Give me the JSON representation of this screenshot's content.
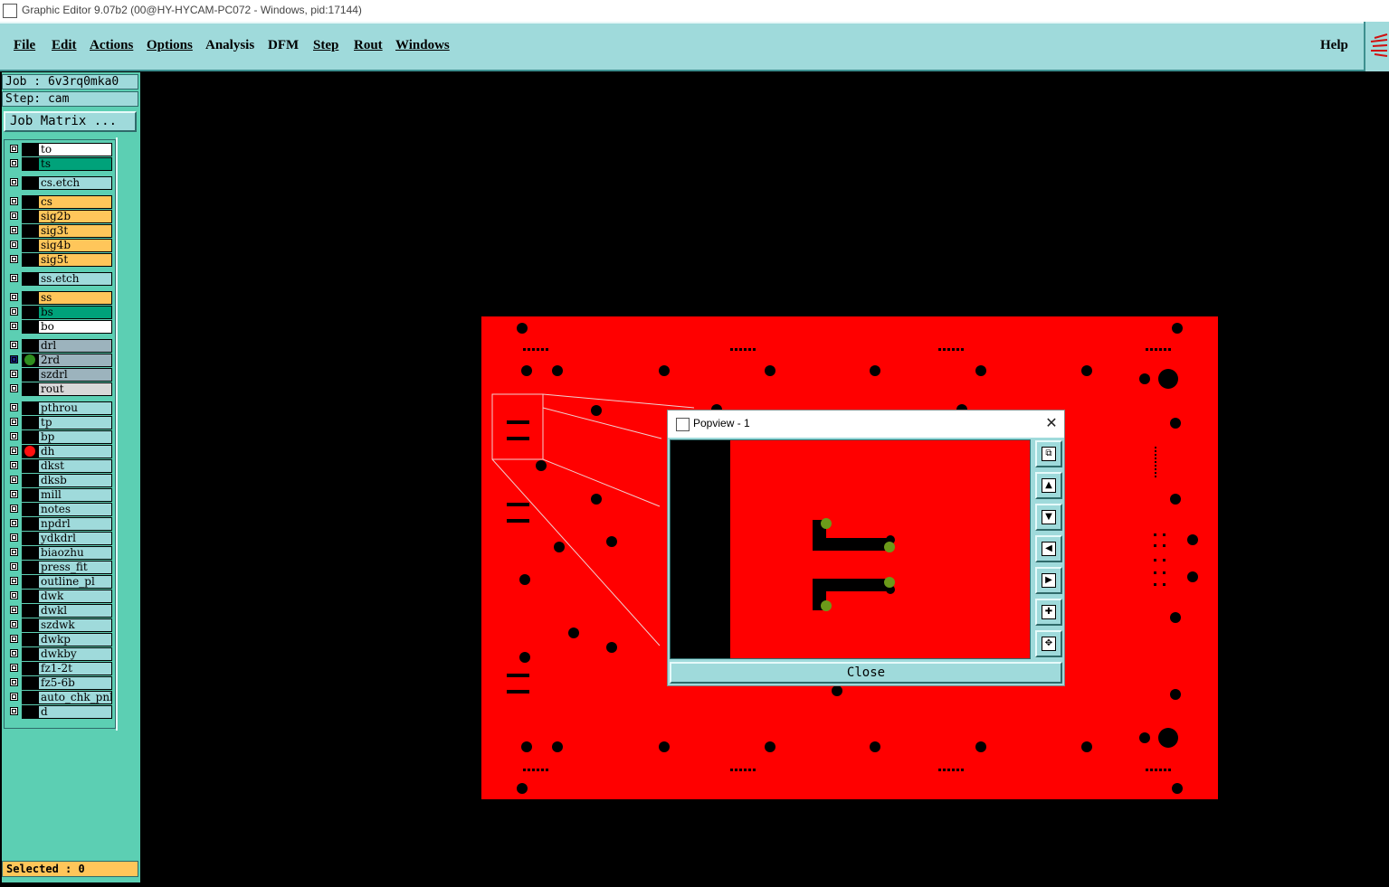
{
  "window": {
    "title": "Graphic Editor 9.07b2 (00@HY-HYCAM-PC072 - Windows, pid:17144)"
  },
  "menu": {
    "file": "File",
    "edit": "Edit",
    "actions": "Actions",
    "options": "Options",
    "analysis": "Analysis",
    "dfm": "DFM",
    "step": "Step",
    "rout": "Rout",
    "windows": "Windows",
    "help": "Help"
  },
  "job": {
    "job_label": "Job  :  6v3rq0mka0",
    "step_label": "Step:  cam",
    "matrix_button": "Job Matrix ..."
  },
  "layers": [
    {
      "name": "to",
      "color": "#ffffff"
    },
    {
      "name": "ts",
      "color": "#00a27a"
    },
    {
      "name": "cs.etch",
      "color": "#9fdadb"
    },
    {
      "name": "cs",
      "color": "#ffc65a"
    },
    {
      "name": "sig2b",
      "color": "#ffc65a"
    },
    {
      "name": "sig3t",
      "color": "#ffc65a"
    },
    {
      "name": "sig4b",
      "color": "#ffc65a"
    },
    {
      "name": "sig5t",
      "color": "#ffc65a"
    },
    {
      "name": "ss.etch",
      "color": "#9fdadb"
    },
    {
      "name": "ss",
      "color": "#ffc65a"
    },
    {
      "name": "bs",
      "color": "#00a27a"
    },
    {
      "name": "bo",
      "color": "#ffffff"
    },
    {
      "name": "drl",
      "color": "#9cb3bd"
    },
    {
      "name": "2rd",
      "color": "#9cb3bd",
      "marker": "#2f8f1f"
    },
    {
      "name": "szdrl",
      "color": "#9cb3bd"
    },
    {
      "name": "rout",
      "color": "#d8d8d8"
    },
    {
      "name": "pthrou",
      "color": "#9fdadb"
    },
    {
      "name": "tp",
      "color": "#9fdadb"
    },
    {
      "name": "bp",
      "color": "#9fdadb"
    },
    {
      "name": "dh",
      "color": "#9fdadb",
      "marker": "#ff1010"
    },
    {
      "name": "dkst",
      "color": "#9fdadb"
    },
    {
      "name": "dksb",
      "color": "#9fdadb"
    },
    {
      "name": "mill",
      "color": "#9fdadb"
    },
    {
      "name": "notes",
      "color": "#9fdadb"
    },
    {
      "name": "npdrl",
      "color": "#9fdadb"
    },
    {
      "name": "ydkdrl",
      "color": "#9fdadb"
    },
    {
      "name": "biaozhu",
      "color": "#9fdadb"
    },
    {
      "name": "press_fit",
      "color": "#9fdadb"
    },
    {
      "name": "outline_pl",
      "color": "#9fdadb"
    },
    {
      "name": "dwk",
      "color": "#9fdadb"
    },
    {
      "name": "dwkl",
      "color": "#9fdadb"
    },
    {
      "name": "szdwk",
      "color": "#9fdadb"
    },
    {
      "name": "dwkp",
      "color": "#9fdadb"
    },
    {
      "name": "dwkby",
      "color": "#9fdadb"
    },
    {
      "name": "fz1-2t",
      "color": "#9fdadb"
    },
    {
      "name": "fz5-6b",
      "color": "#9fdadb"
    },
    {
      "name": "auto_chk_pnl",
      "color": "#9fdadb"
    },
    {
      "name": "d",
      "color": "#9fdadb"
    }
  ],
  "status": {
    "selected": "Selected : 0"
  },
  "popview": {
    "title": "Popview - 1",
    "close_label": "Close"
  },
  "colors": {
    "board": "#ff0000",
    "pad": "#6b9a1a",
    "hole": "#000000"
  }
}
